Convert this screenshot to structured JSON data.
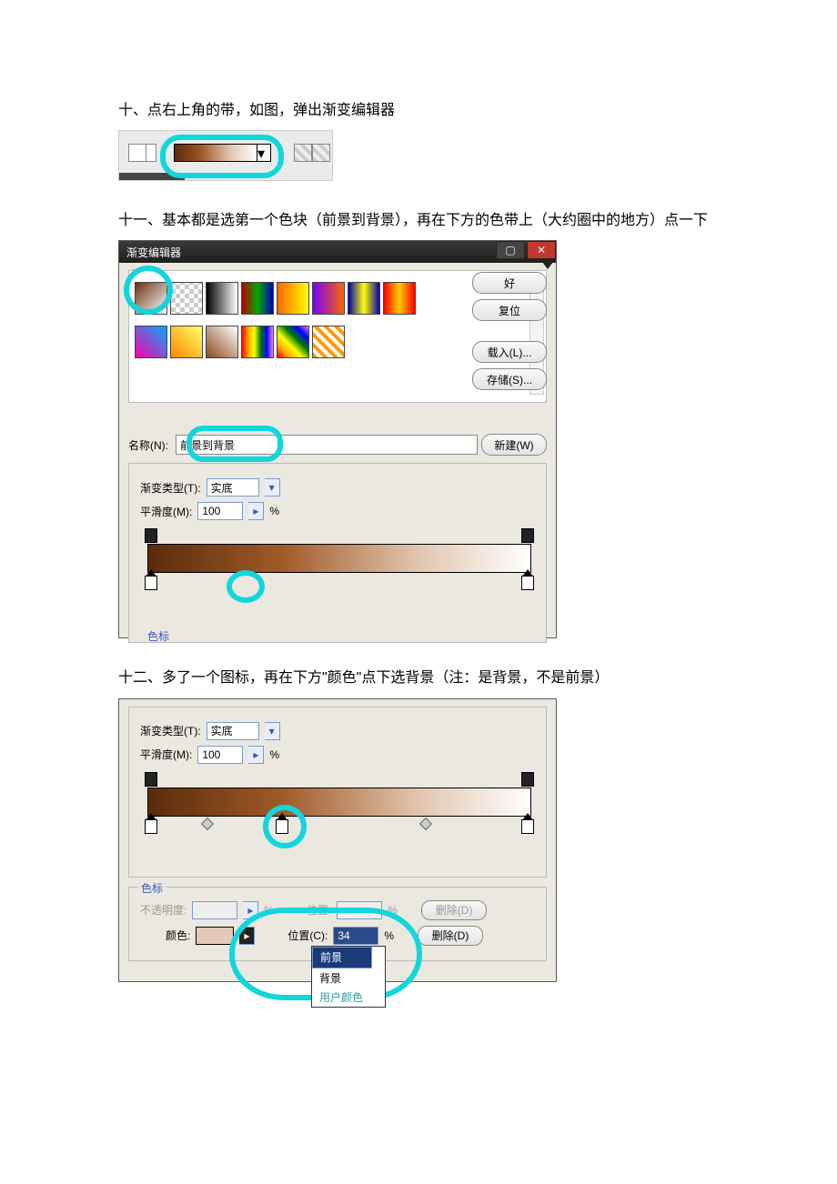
{
  "step10": {
    "text": "十、点右上角的带，如图，弹出渐变编辑器"
  },
  "step11": {
    "text": "十一、基本都是选第一个色块（前景到背景），再在下方的色带上（大约圈中的地方）点一下"
  },
  "step12": {
    "text": "十二、多了一个图标，再在下方\"颜色\"点下选背景（注：是背景，不是前景）"
  },
  "dlg2": {
    "title": "渐变编辑器",
    "presets_label": "预设",
    "ok": "好",
    "reset": "复位",
    "load": "载入(L)...",
    "save": "存储(S)...",
    "name_label": "名称(N):",
    "name_value": "前景到背景",
    "new_btn": "新建(W)",
    "type_label": "渐变类型(T):",
    "type_value": "实底",
    "smooth_label": "平滑度(M):",
    "smooth_value": "100",
    "pct": "%",
    "stops_label": "色标"
  },
  "dlg3": {
    "type_label": "渐变类型(T):",
    "type_value": "实底",
    "smooth_label": "平滑度(M):",
    "smooth_value": "100",
    "pct": "%",
    "stops_label": "色标",
    "opacity_label": "不透明度:",
    "position_label": "位置:",
    "position2_label": "位置(C):",
    "position2_value": "34",
    "color_label": "颜色:",
    "delete": "删除(D)",
    "menu": {
      "foreground": "前景",
      "background": "背景",
      "user": "用户颜色"
    }
  }
}
